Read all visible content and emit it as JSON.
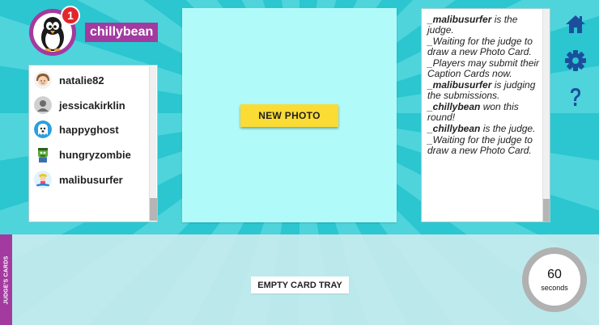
{
  "user": {
    "name": "chillybean",
    "notification_count": "1",
    "avatar_icon": "penguin-avatar"
  },
  "players": [
    {
      "name": "natalie82",
      "icon": "girl-avatar"
    },
    {
      "name": "jessicakirklin",
      "icon": "default-user-avatar"
    },
    {
      "name": "happyghost",
      "icon": "ghost-avatar"
    },
    {
      "name": "hungryzombie",
      "icon": "zombie-avatar"
    },
    {
      "name": "malibusurfer",
      "icon": "surfer-avatar"
    }
  ],
  "photo": {
    "button_label": "NEW PHOTO"
  },
  "log": [
    {
      "actor": "_malibusurfer",
      "text": " is the judge."
    },
    {
      "actor": "",
      "text": "_Waiting for the judge to draw a new Photo Card."
    },
    {
      "actor": "",
      "text": "_Players may submit their Caption Cards now."
    },
    {
      "actor": "_malibusurfer",
      "text": " is judging the submissions."
    },
    {
      "actor": "_chillybean",
      "text": " won this round!"
    },
    {
      "actor": "_chillybean",
      "text": " is the judge."
    },
    {
      "actor": "",
      "text": "_Waiting for the judge to draw a new Photo Card."
    }
  ],
  "nav": {
    "home_icon": "home-icon",
    "settings_icon": "gear-icon",
    "help_icon": "question-icon"
  },
  "tray": {
    "tab_label": "JUDGE'S CARDS",
    "empty_label": "EMPTY CARD TRAY"
  },
  "timer": {
    "value": "60",
    "unit": "seconds"
  },
  "colors": {
    "background": "#2bc6cf",
    "accent_purple": "#a33aa0",
    "photo_area": "#b0fbf9",
    "button_yellow": "#fbdc34",
    "badge_red": "#e2262c",
    "nav_blue": "#1b4f9c"
  }
}
